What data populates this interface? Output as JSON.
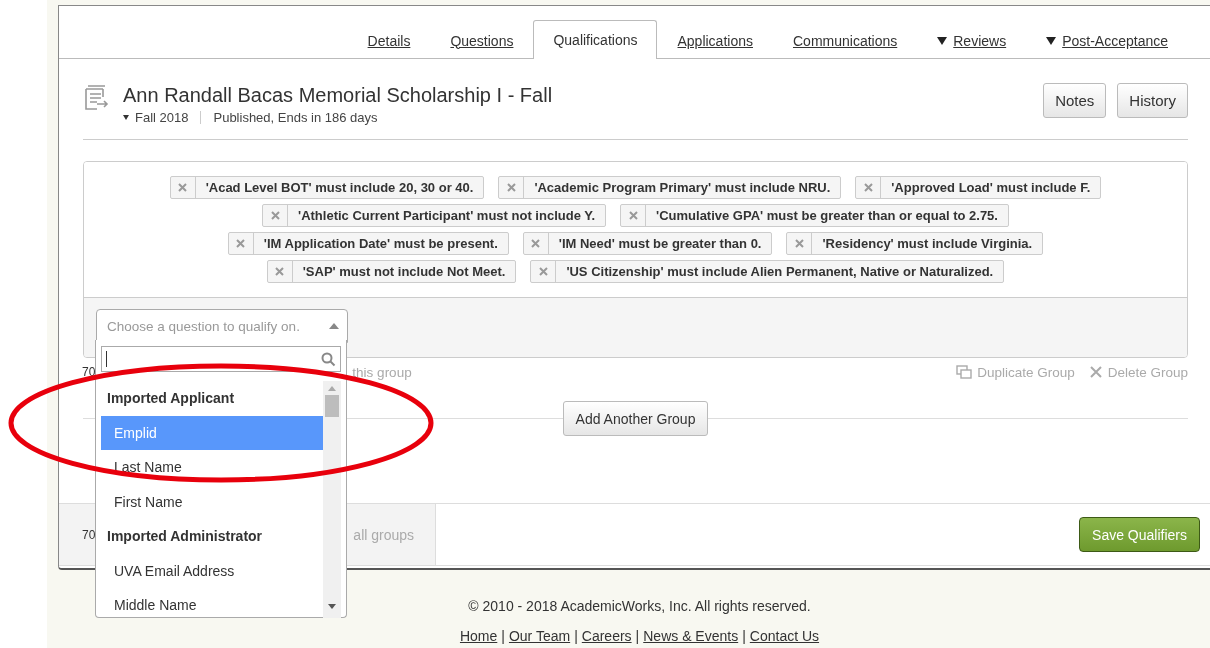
{
  "tabs": [
    {
      "label": "Details",
      "selected": false,
      "has_menu": false
    },
    {
      "label": "Questions",
      "selected": false,
      "has_menu": false
    },
    {
      "label": "Qualifications",
      "selected": true,
      "has_menu": false
    },
    {
      "label": "Applications",
      "selected": false,
      "has_menu": false
    },
    {
      "label": "Communications",
      "selected": false,
      "has_menu": false
    },
    {
      "label": "Reviews",
      "selected": false,
      "has_menu": true
    },
    {
      "label": "Post-Acceptance",
      "selected": false,
      "has_menu": true
    }
  ],
  "opportunity": {
    "title": "Ann Randall Bacas Memorial Scholarship I - Fall",
    "cycle": "Fall 2018",
    "status": "Published, Ends in 186 days",
    "buttons": [
      "Notes",
      "History"
    ]
  },
  "group": {
    "condition_rows": [
      [
        "'Acad Level BOT' must include 20, 30 or 40.",
        "'Academic Program Primary' must include NRU.",
        "'Approved Load' must include F."
      ],
      [
        "'Athletic Current Participant' must not include Y.",
        "'Cumulative GPA' must be greater than or equal to 2.75."
      ],
      [
        "'IM Application Date' must be present.",
        "'IM Need' must be greater than 0.",
        "'Residency' must include Virginia."
      ],
      [
        "'SAP' must not include Not Meet.",
        "'US Citizenship' must include Alien Permanent, Native or Naturalized."
      ]
    ],
    "select": {
      "placeholder": "Choose a question to qualify on.",
      "expanded": true
    },
    "count": "70",
    "count_label": "this group",
    "actions": [
      "Duplicate Group",
      "Delete Group"
    ]
  },
  "dropdown": {
    "items": [
      {
        "kind": "group",
        "label": "Imported Applicant"
      },
      {
        "kind": "option",
        "label": "Emplid",
        "selected": true
      },
      {
        "kind": "option",
        "label": "Last Name",
        "selected": false
      },
      {
        "kind": "option",
        "label": "First Name",
        "selected": false
      },
      {
        "kind": "group",
        "label": "Imported Administrator"
      },
      {
        "kind": "option",
        "label": "UVA Email Address",
        "selected": false
      },
      {
        "kind": "option",
        "label": "Middle Name",
        "selected": false
      }
    ]
  },
  "add_group_button": "Add Another Group",
  "totals": {
    "count": "70",
    "label": "all groups",
    "save_button": "Save Qualifiers"
  },
  "footer": {
    "copyright": "© 2010 - 2018 AcademicWorks, Inc. All rights reserved.",
    "links": [
      "Home",
      "Our Team",
      "Careers",
      "News & Events",
      "Contact Us"
    ],
    "separator": "|"
  }
}
